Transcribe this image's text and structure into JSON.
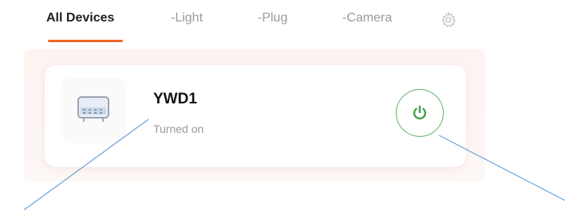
{
  "tabs": [
    {
      "label": "All Devices",
      "active": true
    },
    {
      "label": "-Light",
      "active": false
    },
    {
      "label": "-Plug",
      "active": false
    },
    {
      "label": "-Camera",
      "active": false
    }
  ],
  "settings_icon": "gear-icon",
  "device": {
    "name": "YWD1",
    "status": "Turned on",
    "icon": "device-icon",
    "power_icon": "power-icon"
  },
  "colors": {
    "accent": "#f0662a",
    "power_green": "#4caf50",
    "annotation": "#5b9bd5"
  }
}
